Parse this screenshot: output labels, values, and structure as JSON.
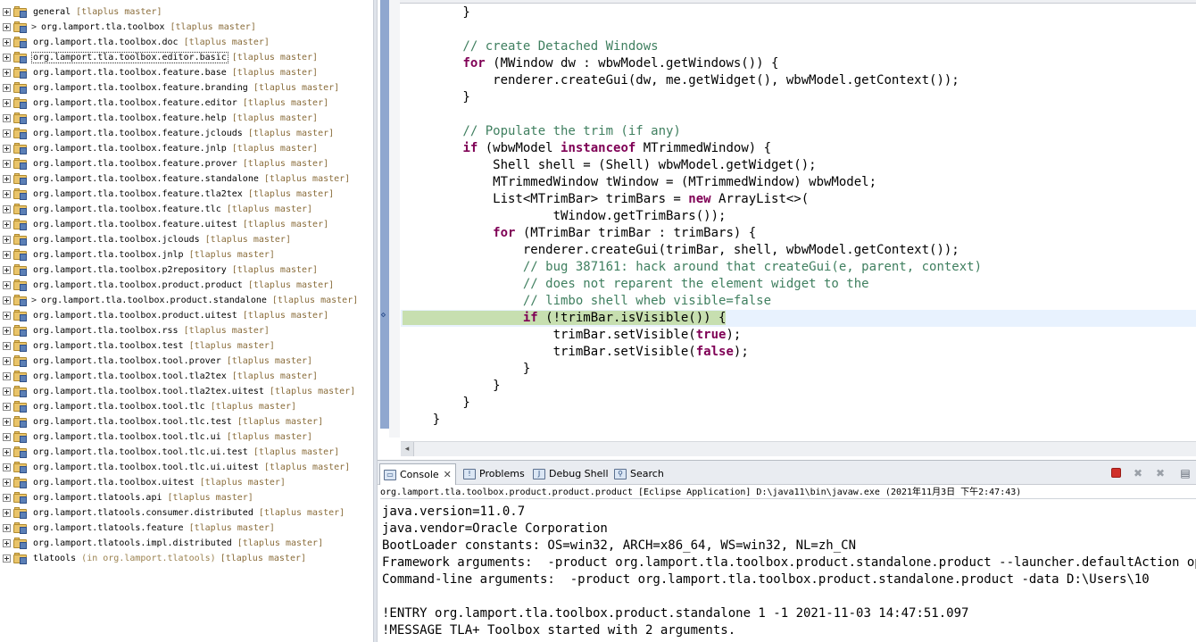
{
  "explorer": {
    "rows": [
      {
        "name": "general",
        "deco": "[tlaplus master]",
        "dirty": false
      },
      {
        "name": "org.lamport.tla.toolbox",
        "deco": "[tlaplus master]",
        "dirty": true
      },
      {
        "name": "org.lamport.tla.toolbox.doc",
        "deco": "[tlaplus master]",
        "dirty": false
      },
      {
        "name": "org.lamport.tla.toolbox.editor.basic",
        "deco": "[tlaplus master]",
        "dirty": false,
        "selected": true
      },
      {
        "name": "org.lamport.tla.toolbox.feature.base",
        "deco": "[tlaplus master]",
        "dirty": false
      },
      {
        "name": "org.lamport.tla.toolbox.feature.branding",
        "deco": "[tlaplus master]",
        "dirty": false
      },
      {
        "name": "org.lamport.tla.toolbox.feature.editor",
        "deco": "[tlaplus master]",
        "dirty": false
      },
      {
        "name": "org.lamport.tla.toolbox.feature.help",
        "deco": "[tlaplus master]",
        "dirty": false
      },
      {
        "name": "org.lamport.tla.toolbox.feature.jclouds",
        "deco": "[tlaplus master]",
        "dirty": false
      },
      {
        "name": "org.lamport.tla.toolbox.feature.jnlp",
        "deco": "[tlaplus master]",
        "dirty": false
      },
      {
        "name": "org.lamport.tla.toolbox.feature.prover",
        "deco": "[tlaplus master]",
        "dirty": false
      },
      {
        "name": "org.lamport.tla.toolbox.feature.standalone",
        "deco": "[tlaplus master]",
        "dirty": false
      },
      {
        "name": "org.lamport.tla.toolbox.feature.tla2tex",
        "deco": "[tlaplus master]",
        "dirty": false
      },
      {
        "name": "org.lamport.tla.toolbox.feature.tlc",
        "deco": "[tlaplus master]",
        "dirty": false
      },
      {
        "name": "org.lamport.tla.toolbox.feature.uitest",
        "deco": "[tlaplus master]",
        "dirty": false
      },
      {
        "name": "org.lamport.tla.toolbox.jclouds",
        "deco": "[tlaplus master]",
        "dirty": false
      },
      {
        "name": "org.lamport.tla.toolbox.jnlp",
        "deco": "[tlaplus master]",
        "dirty": false
      },
      {
        "name": "org.lamport.tla.toolbox.p2repository",
        "deco": "[tlaplus master]",
        "dirty": false
      },
      {
        "name": "org.lamport.tla.toolbox.product.product",
        "deco": "[tlaplus master]",
        "dirty": false
      },
      {
        "name": "org.lamport.tla.toolbox.product.standalone",
        "deco": "[tlaplus master]",
        "dirty": true
      },
      {
        "name": "org.lamport.tla.toolbox.product.uitest",
        "deco": "[tlaplus master]",
        "dirty": false
      },
      {
        "name": "org.lamport.tla.toolbox.rss",
        "deco": "[tlaplus master]",
        "dirty": false
      },
      {
        "name": "org.lamport.tla.toolbox.test",
        "deco": "[tlaplus master]",
        "dirty": false
      },
      {
        "name": "org.lamport.tla.toolbox.tool.prover",
        "deco": "[tlaplus master]",
        "dirty": false
      },
      {
        "name": "org.lamport.tla.toolbox.tool.tla2tex",
        "deco": "[tlaplus master]",
        "dirty": false
      },
      {
        "name": "org.lamport.tla.toolbox.tool.tla2tex.uitest",
        "deco": "[tlaplus master]",
        "dirty": false
      },
      {
        "name": "org.lamport.tla.toolbox.tool.tlc",
        "deco": "[tlaplus master]",
        "dirty": false
      },
      {
        "name": "org.lamport.tla.toolbox.tool.tlc.test",
        "deco": "[tlaplus master]",
        "dirty": false
      },
      {
        "name": "org.lamport.tla.toolbox.tool.tlc.ui",
        "deco": "[tlaplus master]",
        "dirty": false
      },
      {
        "name": "org.lamport.tla.toolbox.tool.tlc.ui.test",
        "deco": "[tlaplus master]",
        "dirty": false
      },
      {
        "name": "org.lamport.tla.toolbox.tool.tlc.ui.uitest",
        "deco": "[tlaplus master]",
        "dirty": false
      },
      {
        "name": "org.lamport.tla.toolbox.uitest",
        "deco": "[tlaplus master]",
        "dirty": false
      },
      {
        "name": "org.lamport.tlatools.api",
        "deco": "[tlaplus master]",
        "dirty": false
      },
      {
        "name": "org.lamport.tlatools.consumer.distributed",
        "deco": "[tlaplus master]",
        "dirty": false
      },
      {
        "name": "org.lamport.tlatools.feature",
        "deco": "[tlaplus master]",
        "dirty": false
      },
      {
        "name": "org.lamport.tlatools.impl.distributed",
        "deco": "[tlaplus master]",
        "dirty": false
      },
      {
        "name": "tlatools",
        "deco_in": "(in org.lamport.tlatools)",
        "deco": "[tlaplus master]",
        "dirty": false
      }
    ]
  },
  "editor": {
    "code_lines": [
      [
        {
          "t": "        }",
          "c": ""
        }
      ],
      [
        {
          "t": "",
          "c": ""
        }
      ],
      [
        {
          "t": "        // create Detached Windows",
          "c": "cm"
        }
      ],
      [
        {
          "t": "        ",
          "c": ""
        },
        {
          "t": "for",
          "c": "kw"
        },
        {
          "t": " (MWindow dw : wbwModel.getWindows()) {",
          "c": ""
        }
      ],
      [
        {
          "t": "            renderer.createGui(dw, me.getWidget(), wbwModel.getContext());",
          "c": ""
        }
      ],
      [
        {
          "t": "        }",
          "c": ""
        }
      ],
      [
        {
          "t": "",
          "c": ""
        }
      ],
      [
        {
          "t": "        // Populate the trim (if any)",
          "c": "cm"
        }
      ],
      [
        {
          "t": "        ",
          "c": ""
        },
        {
          "t": "if",
          "c": "kw"
        },
        {
          "t": " (wbwModel ",
          "c": ""
        },
        {
          "t": "instanceof",
          "c": "kw"
        },
        {
          "t": " MTrimmedWindow) {",
          "c": ""
        }
      ],
      [
        {
          "t": "            Shell shell = (Shell) wbwModel.getWidget();",
          "c": ""
        }
      ],
      [
        {
          "t": "            MTrimmedWindow tWindow = (MTrimmedWindow) wbwModel;",
          "c": ""
        }
      ],
      [
        {
          "t": "            List<MTrimBar> trimBars = ",
          "c": ""
        },
        {
          "t": "new",
          "c": "kw"
        },
        {
          "t": " ArrayList<>(",
          "c": ""
        }
      ],
      [
        {
          "t": "                    tWindow.getTrimBars());",
          "c": ""
        }
      ],
      [
        {
          "t": "            ",
          "c": ""
        },
        {
          "t": "for",
          "c": "kw"
        },
        {
          "t": " (MTrimBar trimBar : trimBars) {",
          "c": ""
        }
      ],
      [
        {
          "t": "                renderer.createGui(trimBar, shell, wbwModel.getContext());",
          "c": ""
        }
      ],
      [
        {
          "t": "                // bug 387161: hack around that createGui(e, parent, context)",
          "c": "cm"
        }
      ],
      [
        {
          "t": "                // does not reparent the element widget to the",
          "c": "cm"
        }
      ],
      [
        {
          "t": "                // limbo shell wheb visible=false",
          "c": "cm"
        }
      ],
      [
        {
          "t": "                ",
          "c": "hl"
        },
        {
          "t": "if",
          "c": "kw hl"
        },
        {
          "t": " (!trimBar.isVisible()) {",
          "c": "hl"
        }
      ],
      [
        {
          "t": "                    trimBar.setVisible(",
          "c": ""
        },
        {
          "t": "true",
          "c": "kw"
        },
        {
          "t": ");",
          "c": ""
        }
      ],
      [
        {
          "t": "                    trimBar.setVisible(",
          "c": ""
        },
        {
          "t": "false",
          "c": "kw"
        },
        {
          "t": ");",
          "c": ""
        }
      ],
      [
        {
          "t": "                }",
          "c": ""
        }
      ],
      [
        {
          "t": "            }",
          "c": ""
        }
      ],
      [
        {
          "t": "        }",
          "c": ""
        }
      ],
      [
        {
          "t": "    }",
          "c": ""
        }
      ]
    ],
    "current_line_index": 18,
    "ruler_marker_glyph": "⋄"
  },
  "console": {
    "tabs": [
      {
        "label": "Console",
        "icon": "console-icon",
        "glyph": "▭",
        "closable": true,
        "active": true
      },
      {
        "label": "Problems",
        "icon": "problems-icon",
        "glyph": "!",
        "closable": false,
        "active": false
      },
      {
        "label": "Debug Shell",
        "icon": "debug-shell-icon",
        "glyph": "J",
        "closable": false,
        "active": false
      },
      {
        "label": "Search",
        "icon": "search-icon",
        "glyph": "⚲",
        "closable": false,
        "active": false
      }
    ],
    "close_glyph": "✕",
    "toolbar": {
      "remove_glyph": "✖",
      "remove_all_glyph": "✖",
      "clear_glyph": "▤"
    },
    "description": "org.lamport.tla.toolbox.product.product.product [Eclipse Application] D:\\java11\\bin\\javaw.exe  (2021年11月3日 下午2:47:43)",
    "output_lines": [
      "java.version=11.0.7",
      "java.vendor=Oracle Corporation",
      "BootLoader constants: OS=win32, ARCH=x86_64, WS=win32, NL=zh_CN",
      "Framework arguments:  -product org.lamport.tla.toolbox.product.standalone.product --launcher.defaultAction openFile",
      "Command-line arguments:  -product org.lamport.tla.toolbox.product.standalone.product -data D:\\Users\\10",
      "",
      "!ENTRY org.lamport.tla.toolbox.product.standalone 1 -1 2021-11-03 14:47:51.097",
      "!MESSAGE TLA+ Toolbox started with 2 arguments."
    ]
  },
  "colors": {
    "keyword": "#7f0055",
    "comment": "#3f7f5f",
    "current_line": "#e8f2fe",
    "breakpoint_highlight": "#c7dfb0",
    "decoration": "#8a6d3b"
  }
}
